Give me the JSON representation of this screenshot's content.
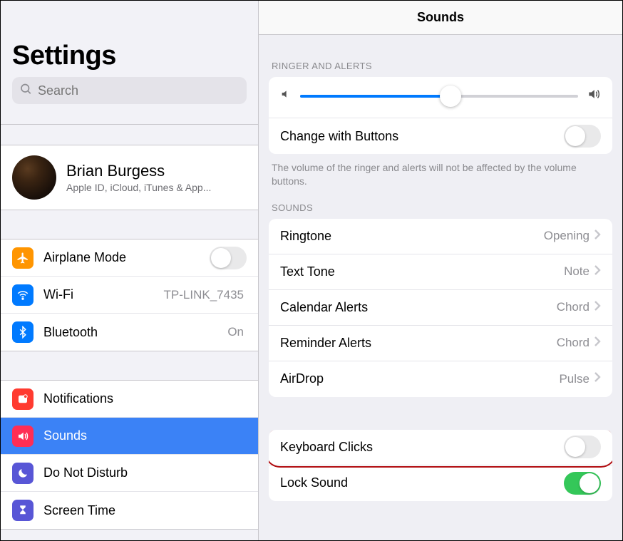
{
  "sidebar": {
    "title": "Settings",
    "search_placeholder": "Search",
    "profile": {
      "name": "Brian Burgess",
      "subtitle": "Apple ID, iCloud, iTunes & App..."
    },
    "group1": {
      "airplane": "Airplane Mode",
      "wifi": "Wi-Fi",
      "wifi_value": "TP-LINK_7435",
      "bluetooth": "Bluetooth",
      "bluetooth_value": "On"
    },
    "group2": {
      "notifications": "Notifications",
      "sounds": "Sounds",
      "dnd": "Do Not Disturb",
      "screentime": "Screen Time"
    }
  },
  "detail": {
    "title": "Sounds",
    "section_ringer": "RINGER AND ALERTS",
    "change_with_buttons": "Change with Buttons",
    "ringer_footer": "The volume of the ringer and alerts will not be affected by the volume buttons.",
    "section_sounds": "SOUNDS",
    "ringtone": {
      "label": "Ringtone",
      "value": "Opening"
    },
    "texttone": {
      "label": "Text Tone",
      "value": "Note"
    },
    "calendar": {
      "label": "Calendar Alerts",
      "value": "Chord"
    },
    "reminder": {
      "label": "Reminder Alerts",
      "value": "Chord"
    },
    "airdrop": {
      "label": "AirDrop",
      "value": "Pulse"
    },
    "keyboard_clicks": "Keyboard Clicks",
    "lock_sound": "Lock Sound",
    "slider_percent": 54
  },
  "colors": {
    "accent": "#007aff",
    "selected": "#3b82f6",
    "green": "#34c759",
    "airplane": "#ff9500",
    "wifi": "#007aff",
    "bluetooth": "#007aff",
    "notifications": "#ff3b30",
    "sounds": "#ff2d55",
    "dnd": "#5856d6",
    "screentime": "#5856d6"
  }
}
